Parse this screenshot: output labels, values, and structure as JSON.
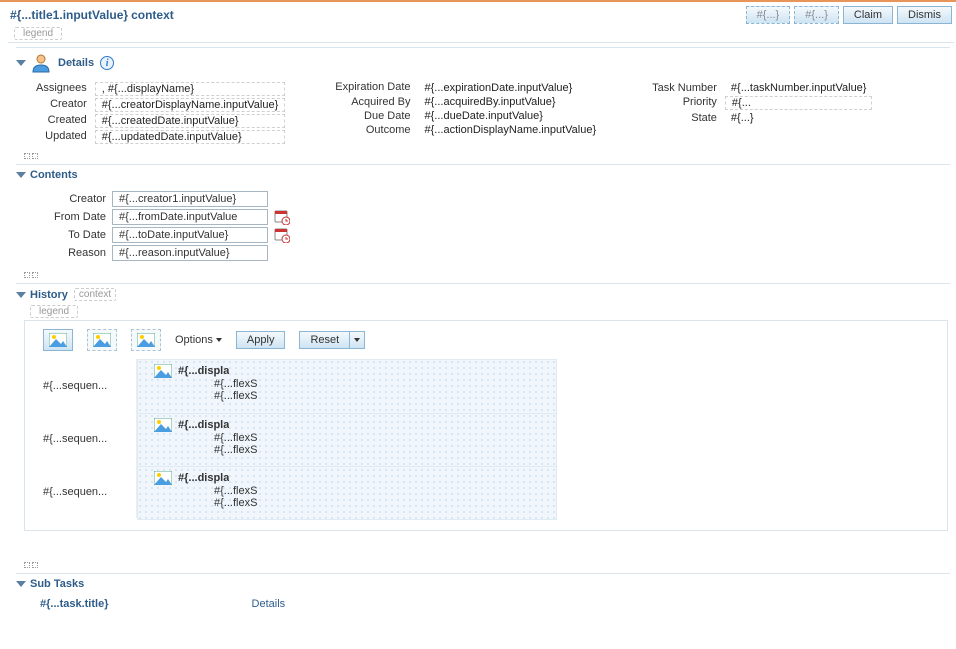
{
  "header": {
    "title": "#{...title1.inputValue}",
    "context_label": "context",
    "buttons": {
      "ghost1": "#{...}",
      "ghost2": "#{...}",
      "claim": "Claim",
      "dismiss": "Dismis"
    }
  },
  "legend_label": "legend",
  "details_panel": {
    "title": "Details",
    "labels": {
      "assignees": "Assignees",
      "creator": "Creator",
      "created": "Created",
      "updated": "Updated",
      "expiration_date": "Expiration Date",
      "acquired_by": "Acquired By",
      "due_date": "Due Date",
      "outcome": "Outcome",
      "task_number": "Task Number",
      "priority": "Priority",
      "state": "State"
    },
    "values": {
      "assignees": "  , #{...displayName}",
      "creator": "#{...creatorDisplayName.inputValue}",
      "created": "#{...createdDate.inputValue}",
      "updated": "#{...updatedDate.inputValue}",
      "expiration_date": "#{...expirationDate.inputValue}",
      "acquired_by": "#{...acquiredBy.inputValue}",
      "due_date": "#{...dueDate.inputValue}",
      "outcome": "#{...actionDisplayName.inputValue}",
      "task_number": "#{...taskNumber.inputValue}",
      "priority": "#{...",
      "state": "#{...}"
    }
  },
  "contents_panel": {
    "title": "Contents",
    "labels": {
      "creator": "Creator",
      "from_date": "From Date",
      "to_date": "To Date",
      "reason": "Reason"
    },
    "values": {
      "creator": "#{...creator1.inputValue}",
      "from_date": "#{...fromDate.inputValue",
      "to_date": "#{...toDate.inputValue}",
      "reason": "#{...reason.inputValue}"
    }
  },
  "history_panel": {
    "title": "History",
    "context_label": "context",
    "legend_label": "legend",
    "options_label": "Options",
    "apply_label": "Apply",
    "reset_label": "Reset",
    "sequence_cell": "#{...sequen...",
    "display_title": "#{...displa",
    "flex_line1": "#{...flexS",
    "flex_line2": "#{...flexS"
  },
  "subtasks_panel": {
    "title": "Sub Tasks",
    "task_title_placeholder": "#{...task.title}",
    "details_link": "Details"
  }
}
